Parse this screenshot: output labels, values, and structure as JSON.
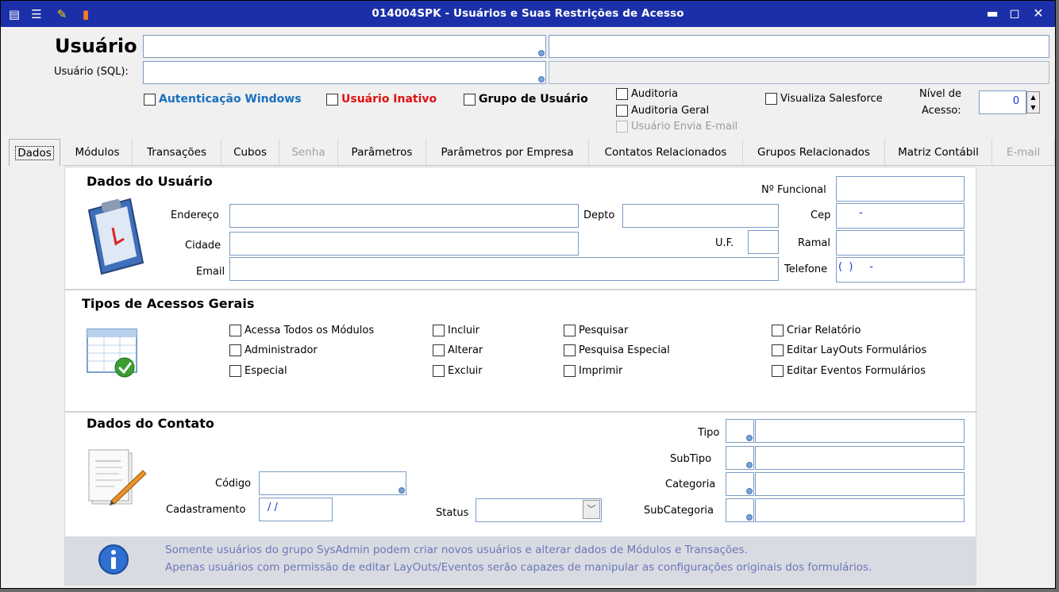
{
  "window": {
    "title": "014004SPK - Usuários e Suas Restrições de Acesso",
    "controls": {
      "minimize": "▬",
      "maximize": "◻",
      "close": "✕"
    }
  },
  "header": {
    "usuario_label": "Usuário",
    "usuario_sql_label": "Usuário (SQL):",
    "checkboxes": {
      "autenticacao_windows": "Autenticação Windows",
      "usuario_inativo": "Usuário Inativo",
      "grupo_usuario": "Grupo de Usuário",
      "auditoria": "Auditoria",
      "auditoria_geral": "Auditoria Geral",
      "usuario_envia_email": "Usuário Envia E-mail",
      "visualiza_salesforce": "Visualiza Salesforce"
    },
    "nivel_acesso_label_1": "Nível de",
    "nivel_acesso_label_2": "Acesso:",
    "nivel_acesso_value": "0"
  },
  "tabs": [
    "Dados",
    "Módulos",
    "Transações",
    "Cubos",
    "Senha",
    "Parâmetros",
    "Parâmetros por Empresa",
    "Contatos Relacionados",
    "Grupos Relacionados",
    "Matriz Contábil",
    "E-mail"
  ],
  "dados_usuario": {
    "title": "Dados do Usuário",
    "endereco": "Endereço",
    "depto": "Depto",
    "cidade": "Cidade",
    "uf": "U.F.",
    "email": "Email",
    "n_funcional": "Nº Funcional",
    "cep": "Cep",
    "cep_mask": "-",
    "ramal": "Ramal",
    "telefone": "Telefone",
    "telefone_mask": "(  )     -"
  },
  "tipos_acessos": {
    "title": "Tipos de Acessos Gerais",
    "col1": [
      "Acessa Todos os Módulos",
      "Administrador",
      "Especial"
    ],
    "col2": [
      "Incluir",
      "Alterar",
      "Excluir"
    ],
    "col3": [
      "Pesquisar",
      "Pesquisa Especial",
      "Imprimir"
    ],
    "col4": [
      "Criar Relatório",
      "Editar LayOuts Formulários",
      "Editar Eventos Formulários"
    ]
  },
  "dados_contato": {
    "title": "Dados do Contato",
    "codigo": "Código",
    "cadastramento": "Cadastramento",
    "cadastramento_mask": "/ /",
    "status": "Status",
    "tipo": "Tipo",
    "subtipo": "SubTipo",
    "categoria": "Categoria",
    "subcategoria": "SubCategoria"
  },
  "info": {
    "line1": "Somente usuários do grupo SysAdmin podem criar novos usuários e alterar dados de Módulos e Transações.",
    "line2": "Apenas usuários com permissão de editar LayOuts/Eventos serão capazes de manipular as configurações originais dos formulários."
  },
  "colors": {
    "titlebar": "#1b2fa8",
    "autenticacao": "#1a6fc0",
    "inativo": "#e01010",
    "info_text": "#6b77b5"
  }
}
